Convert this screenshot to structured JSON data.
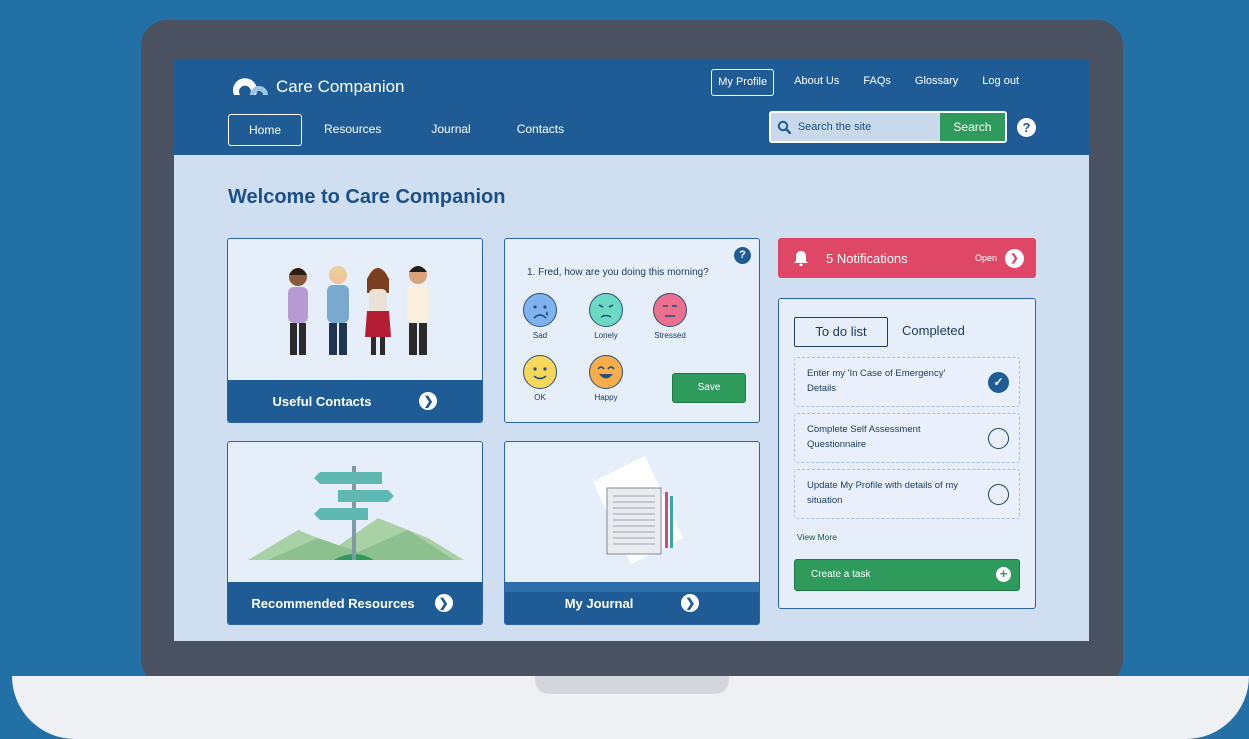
{
  "app": {
    "name": "Care Companion"
  },
  "topnav": [
    "My Profile",
    "About Us",
    "FAQs",
    "Glossary",
    "Log out"
  ],
  "mainnav": [
    "Home",
    "Resources",
    "Journal",
    "Contacts"
  ],
  "search": {
    "placeholder": "Search the site",
    "button": "Search",
    "help": "?"
  },
  "page": {
    "title": "Welcome to Care Companion"
  },
  "cards": {
    "contacts": {
      "label": "Useful Contacts"
    },
    "resources": {
      "label": "Recommended Resources"
    },
    "journal": {
      "label": "My Journal"
    }
  },
  "mood": {
    "question": "1. Fred, how are you doing this morning?",
    "help": "?",
    "options": [
      {
        "label": "Sad",
        "color": "#7fb2ee"
      },
      {
        "label": "Lonely",
        "color": "#6cd9c4"
      },
      {
        "label": "Stressed",
        "color": "#ec6f8f"
      },
      {
        "label": "OK",
        "color": "#f5d85b"
      },
      {
        "label": "Happy",
        "color": "#f7ad4a"
      }
    ],
    "save": "Save"
  },
  "notifications": {
    "label": "5 Notifications",
    "action": "Open"
  },
  "todo": {
    "tabs": [
      "To do list",
      "Completed"
    ],
    "tasks": [
      {
        "text": "Enter my 'In Case of Emergency' Details",
        "done": true
      },
      {
        "text": "Complete Self Assessment Questionnaire",
        "done": false
      },
      {
        "text": "Update My Profile with details of my situation",
        "done": false
      }
    ],
    "view_more": "View More",
    "create": "Create a task"
  },
  "colors": {
    "header": "#1f5c95",
    "accent_green": "#2e9a5c",
    "notification": "#df4767",
    "background": "#cfdff1"
  }
}
